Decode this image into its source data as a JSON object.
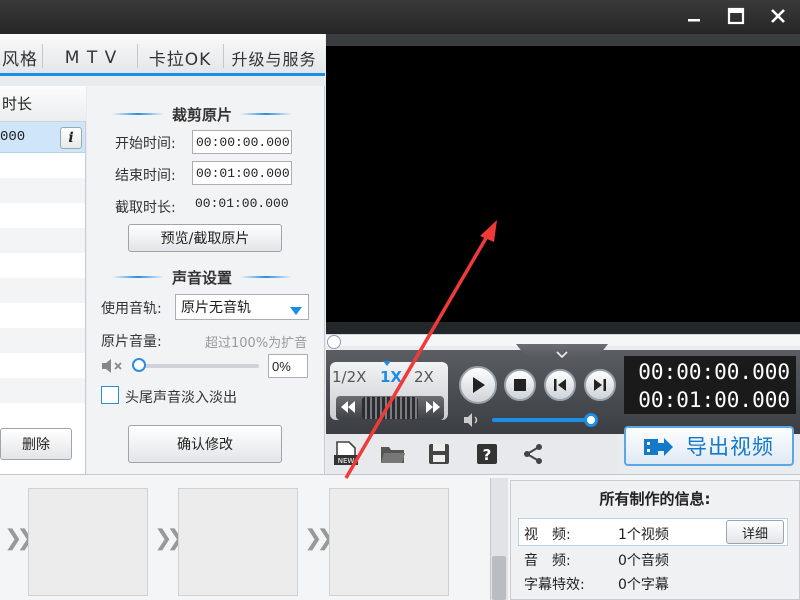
{
  "window": {
    "controls": [
      "minimize-icon",
      "maximize-icon",
      "close-icon"
    ]
  },
  "tabs": [
    {
      "label": "风格"
    },
    {
      "label": "M T V"
    },
    {
      "label": "卡拉OK"
    },
    {
      "label": "升级与服务"
    }
  ],
  "clip_list": {
    "header": "时长",
    "row_value": "000",
    "info_icon": "i",
    "delete_label": "删除"
  },
  "crop": {
    "title": "裁剪原片",
    "start_label": "开始时间:",
    "start_value": "00:00:00.000",
    "end_label": "结束时间:",
    "end_value": "00:01:00.000",
    "duration_label": "截取时长:",
    "duration_value": "00:01:00.000",
    "preview_button": "预览/截取原片"
  },
  "audio": {
    "title": "声音设置",
    "track_label": "使用音轨:",
    "track_value": "原片无音轨",
    "volume_label": "原片音量:",
    "volume_hint": "超过100%为扩音",
    "volume_value": "0%",
    "fade_label": "头尾声音淡入淡出",
    "fade_checked": false,
    "confirm_button": "确认修改"
  },
  "player": {
    "speeds": [
      "1/2X",
      "1X",
      "2X"
    ],
    "selected_speed": "1X",
    "current_time": "00:00:00.000",
    "total_time": "00:01:00.000",
    "progress": 0,
    "volume": 0.9
  },
  "toolbar": {
    "icons": [
      "new-project-icon",
      "open-folder-icon",
      "save-icon",
      "help-icon",
      "share-icon"
    ],
    "new_badge": "NEW"
  },
  "export": {
    "label": "导出视频"
  },
  "info": {
    "title": "所有制作的信息:",
    "rows": [
      {
        "label": "视　频:",
        "value": "1个视频"
      },
      {
        "label": "音　频:",
        "value": "0个音频"
      },
      {
        "label": "字幕特效:",
        "value": "0个字幕"
      }
    ],
    "detail_button": "详细"
  },
  "colors": {
    "accent": "#1c8ee6",
    "annotation_arrow": "#f03a3a"
  }
}
